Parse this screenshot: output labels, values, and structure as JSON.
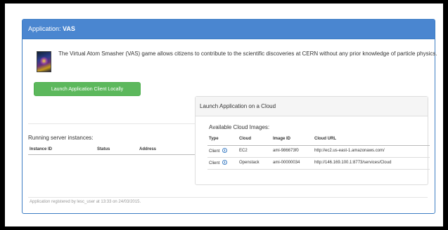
{
  "panel": {
    "title_prefix": "Application: ",
    "title_name": "VAS"
  },
  "app": {
    "thumbnail_icon": "vas-atom-image",
    "description": "The Virtual Atom Smasher (VAS) game allows citizens to contribute to the scientific discoveries at CERN without any prior knowledge of particle physics.",
    "launch_local_label": "Launch Application Client Locally"
  },
  "servers": {
    "title": "Running server instances:",
    "columns": [
      "Instance ID",
      "Status",
      "Address"
    ]
  },
  "cloud": {
    "title": "Launch Application on a Cloud",
    "subtitle": "Available Cloud Images:",
    "columns": [
      "Type",
      "Cloud",
      "Image ID",
      "Cloud URL"
    ],
    "rows": [
      {
        "type": "Client",
        "cloud": "EC2",
        "image_id": "ami-986673f0",
        "url": "http://ec2.us-east-1.amazonaws.com/"
      },
      {
        "type": "Client",
        "cloud": "Openstack",
        "image_id": "ami-00000034",
        "url": "http://146.169.100.1:8773/services/Cloud"
      }
    ]
  },
  "footer": {
    "text": "Application registered by lesc_user at 13:33 on 24/03/2015."
  },
  "colors": {
    "heading": "#4a86d0",
    "button": "#5cb85c"
  }
}
